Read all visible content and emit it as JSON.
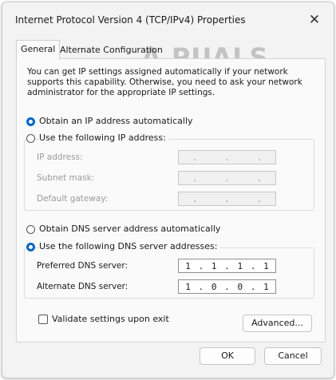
{
  "window": {
    "title": "Internet Protocol Version 4 (TCP/IPv4) Properties",
    "watermark": "A PUALS"
  },
  "tabs": [
    {
      "label": "General",
      "active": true
    },
    {
      "label": "Alternate Configuration",
      "active": false
    }
  ],
  "intro_text": "You can get IP settings assigned automatically if your network supports this capability. Otherwise, you need to ask your network administrator for the appropriate IP settings.",
  "ip_section": {
    "auto_label": "Obtain an IP address automatically",
    "auto_selected": true,
    "manual_label": "Use the following IP address:",
    "manual_selected": false,
    "fields": [
      {
        "label": "IP address:",
        "octets": [
          ".",
          ".",
          "."
        ]
      },
      {
        "label": "Subnet mask:",
        "octets": [
          ".",
          ".",
          "."
        ]
      },
      {
        "label": "Default gateway:",
        "octets": [
          ".",
          ".",
          "."
        ]
      }
    ]
  },
  "dns_section": {
    "auto_label": "Obtain DNS server address automatically",
    "auto_selected": false,
    "manual_label": "Use the following DNS server addresses:",
    "manual_selected": true,
    "preferred_label": "Preferred DNS server:",
    "preferred_value": [
      "1",
      "1",
      "1",
      "1"
    ],
    "alternate_label": "Alternate DNS server:",
    "alternate_value": [
      "1",
      "0",
      "0",
      "1"
    ]
  },
  "validate_label": "Validate settings upon exit",
  "validate_checked": false,
  "buttons": {
    "advanced": "Advanced...",
    "ok": "OK",
    "cancel": "Cancel"
  },
  "colors": {
    "accent": "#0067c0"
  }
}
